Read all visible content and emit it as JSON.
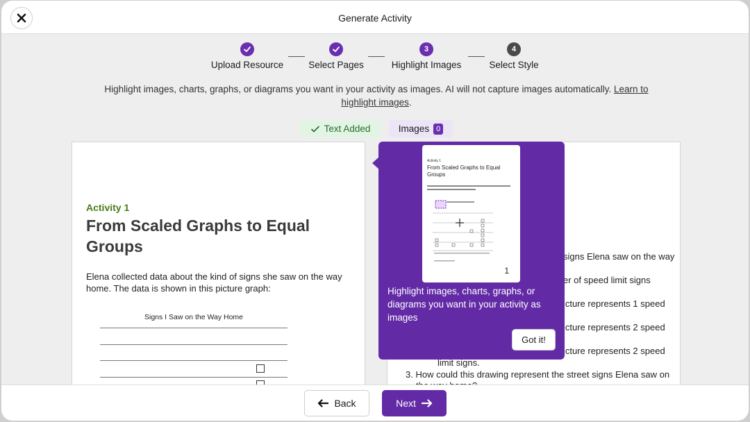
{
  "header": {
    "title": "Generate Activity",
    "close_icon": "close-icon"
  },
  "stepper": {
    "steps": [
      {
        "label": "Upload Resource",
        "state": "done",
        "marker": ""
      },
      {
        "label": "Select Pages",
        "state": "done",
        "marker": ""
      },
      {
        "label": "Highlight Images",
        "state": "current",
        "marker": "3"
      },
      {
        "label": "Select Style",
        "state": "pending",
        "marker": "4"
      }
    ]
  },
  "instructions": {
    "text": "Highlight images, charts, graphs, or diagrams you want in your activity as images. AI will not capture images automatically.",
    "link_part1": "Learn to",
    "link_part2": "highlight images",
    "suffix": "."
  },
  "tabs": {
    "text_added": "Text Added",
    "images_label": "Images",
    "images_count": "0"
  },
  "left_page": {
    "activity_label": "Activity 1",
    "title": "From Scaled Graphs to Equal Groups",
    "body": "Elena collected data about the kind of signs she saw on the way home. The data is shown in this picture graph:",
    "graph_title": "Signs I Saw on the Way Home"
  },
  "right_page": {
    "lines": [
      "signs Elena saw on the way",
      "er of speed limit signs",
      "icture represents 1 speed",
      "icture represents 2 speed",
      "icture represents 2 speed",
      "limit signs.",
      "3.  How could this drawing represent the street signs Elena saw on",
      "the way home?"
    ]
  },
  "popover": {
    "thumb_activity": "Activity 1",
    "thumb_title": "From Scaled Graphs to Equal Groups",
    "thumb_page": "1",
    "text": "Highlight images, charts, graphs, or diagrams you want in your activity as images",
    "button": "Got it!"
  },
  "footer": {
    "back": "Back",
    "next": "Next"
  },
  "colors": {
    "accent": "#632aa6",
    "success_bg": "#e2f5e4",
    "success_text": "#2a6b2f"
  }
}
